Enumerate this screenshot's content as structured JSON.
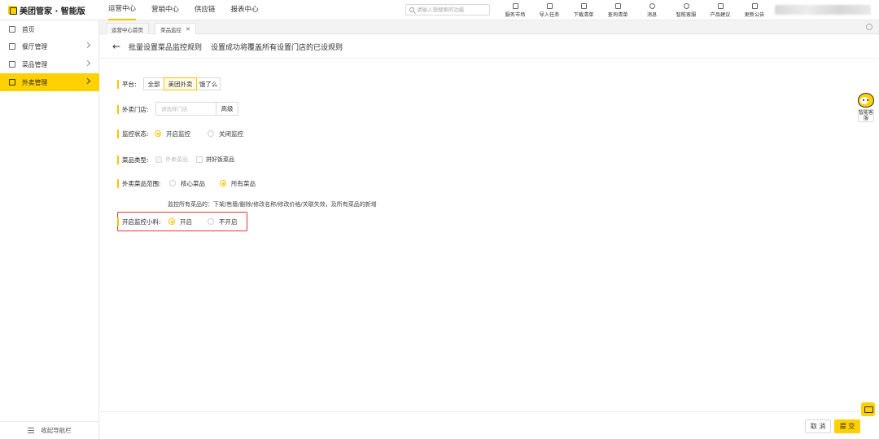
{
  "app": {
    "brand": "美团管家 · 智能版"
  },
  "topnav": [
    {
      "label": "运营中心",
      "active": true
    },
    {
      "label": "营销中心",
      "active": false
    },
    {
      "label": "供应链",
      "active": false
    },
    {
      "label": "报表中心",
      "active": false
    }
  ],
  "search": {
    "placeholder": "请输入想搜索的功能",
    "icon": "search-icon"
  },
  "tools": [
    {
      "label": "服务市场",
      "icon": "store-icon"
    },
    {
      "label": "导入任务",
      "icon": "import-icon"
    },
    {
      "label": "下载清单",
      "icon": "download-icon"
    },
    {
      "label": "查询清单",
      "icon": "query-icon"
    },
    {
      "label": "消息",
      "icon": "bell-icon"
    },
    {
      "label": "智能客服",
      "icon": "service-icon"
    },
    {
      "label": "产品建议",
      "icon": "suggestion-icon"
    },
    {
      "label": "更新公告",
      "icon": "announcement-icon"
    }
  ],
  "sidebar": {
    "items": [
      {
        "label": "首页",
        "icon": "home-icon",
        "active": false,
        "arrow": false
      },
      {
        "label": "餐厅管理",
        "icon": "restaurant-icon",
        "active": false,
        "arrow": true
      },
      {
        "label": "菜品管理",
        "icon": "dish-icon",
        "active": false,
        "arrow": true
      },
      {
        "label": "外卖管理",
        "icon": "delivery-icon",
        "active": true,
        "arrow": true
      }
    ],
    "collapse_label": "收起导航栏"
  },
  "tabs": [
    {
      "label": "运营中心首页",
      "closable": false,
      "active": false
    },
    {
      "label": "菜品监控",
      "closable": true,
      "active": true
    }
  ],
  "page": {
    "title": "批量设置菜品监控规则",
    "subtitle": "设置成功将覆盖所有设置门店的已设规则"
  },
  "form": {
    "platform": {
      "label": "平台:",
      "options": [
        "全部",
        "美团外卖",
        "饿了么"
      ],
      "selected": "美团外卖"
    },
    "store": {
      "label": "外卖门店:",
      "placeholder": "请选择门店",
      "advanced_label": "高级"
    },
    "monitor_status": {
      "label": "监控状态:",
      "options": [
        "开启监控",
        "关闭监控"
      ],
      "selected": "开启监控"
    },
    "dish_type": {
      "label": "菜品类型:",
      "options": [
        {
          "label": "外卖菜品",
          "checked": false,
          "disabled": true
        },
        {
          "label": "拼好饭菜品",
          "checked": false,
          "disabled": false
        }
      ]
    },
    "dish_scope": {
      "label": "外卖菜品范围:",
      "options": [
        "核心菜品",
        "所有菜品"
      ],
      "selected": "所有菜品",
      "hint": "监控所有菜品的：下架/售罄/删除/修改名称/修改价格/关联失效，及所有菜品的新增"
    },
    "monitor_addon": {
      "label": "开启监控小料:",
      "options": [
        "开启",
        "不开启"
      ],
      "selected": "开启"
    }
  },
  "footer": {
    "cancel_label": "取 消",
    "submit_label": "提 交"
  },
  "assistant": {
    "label": "智能客服"
  },
  "colors": {
    "accent": "#ffd100",
    "highlight": "#e53935"
  }
}
